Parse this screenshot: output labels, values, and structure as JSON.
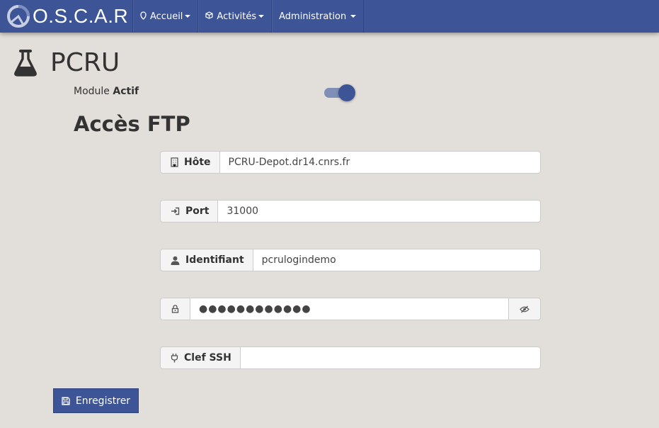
{
  "navbar": {
    "brand": "O.S.C.A.R",
    "items": [
      {
        "label": "Accueil",
        "icon": "home-icon"
      },
      {
        "label": "Activités",
        "icon": "cube-icon"
      },
      {
        "label": "Administration",
        "icon": ""
      }
    ],
    "background": "#3d5597"
  },
  "page": {
    "title": "PCRU",
    "icon": "flask-icon"
  },
  "module": {
    "label": "Module",
    "state": "Actif",
    "enabled": true
  },
  "ftp": {
    "title": "Accès FTP",
    "host": {
      "label": "Hôte",
      "value": "PCRU-Depot.dr14.cnrs.fr",
      "icon": "building-icon"
    },
    "port": {
      "label": "Port",
      "value": "31000",
      "icon": "login-icon"
    },
    "identifiant": {
      "label": "Identifiant",
      "value": "pcrulogindemo",
      "icon": "user-icon"
    },
    "password": {
      "value": "●●●●●●●●●●●●",
      "icon": "lock-icon",
      "toggle_icon": "eye-slash-icon"
    },
    "ssh_key": {
      "label": "Clef SSH",
      "value": "",
      "icon": "plug-icon"
    }
  },
  "actions": {
    "save_label": "Enregistrer"
  }
}
